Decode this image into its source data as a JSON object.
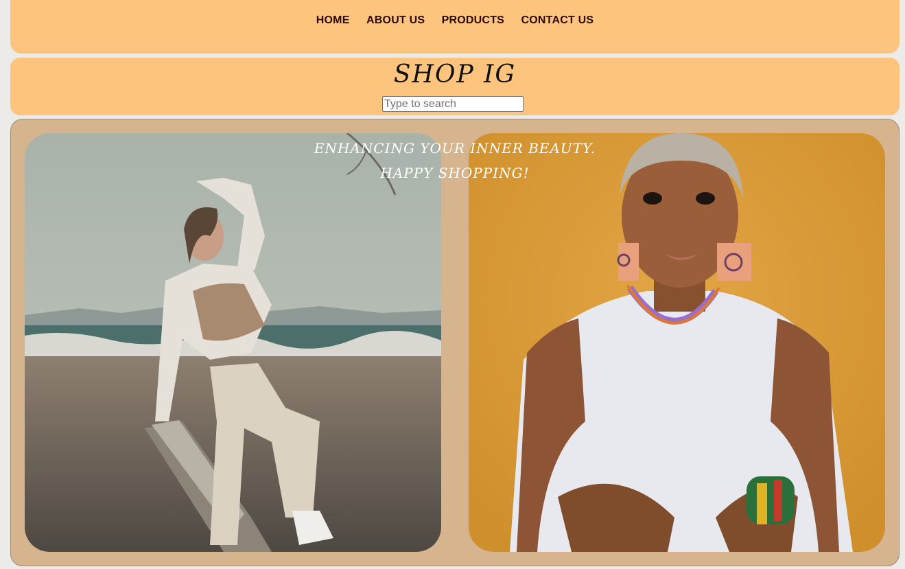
{
  "nav": {
    "items": [
      {
        "label": "HOME"
      },
      {
        "label": "ABOUT US"
      },
      {
        "label": "PRODUCTS"
      },
      {
        "label": "CONTACT US"
      }
    ]
  },
  "header": {
    "title": "SHOP IG"
  },
  "search": {
    "placeholder": "Type to search",
    "value": ""
  },
  "hero": {
    "tagline_line1": "ENHANCING YOUR INNER BEAUTY.",
    "tagline_line2": "HAPPY SHOPPING!"
  },
  "colors": {
    "bar_background": "#fdc47e",
    "hero_background": "#d6b48e",
    "page_background": "#ecebe8",
    "nav_text": "#2a0a0a"
  }
}
